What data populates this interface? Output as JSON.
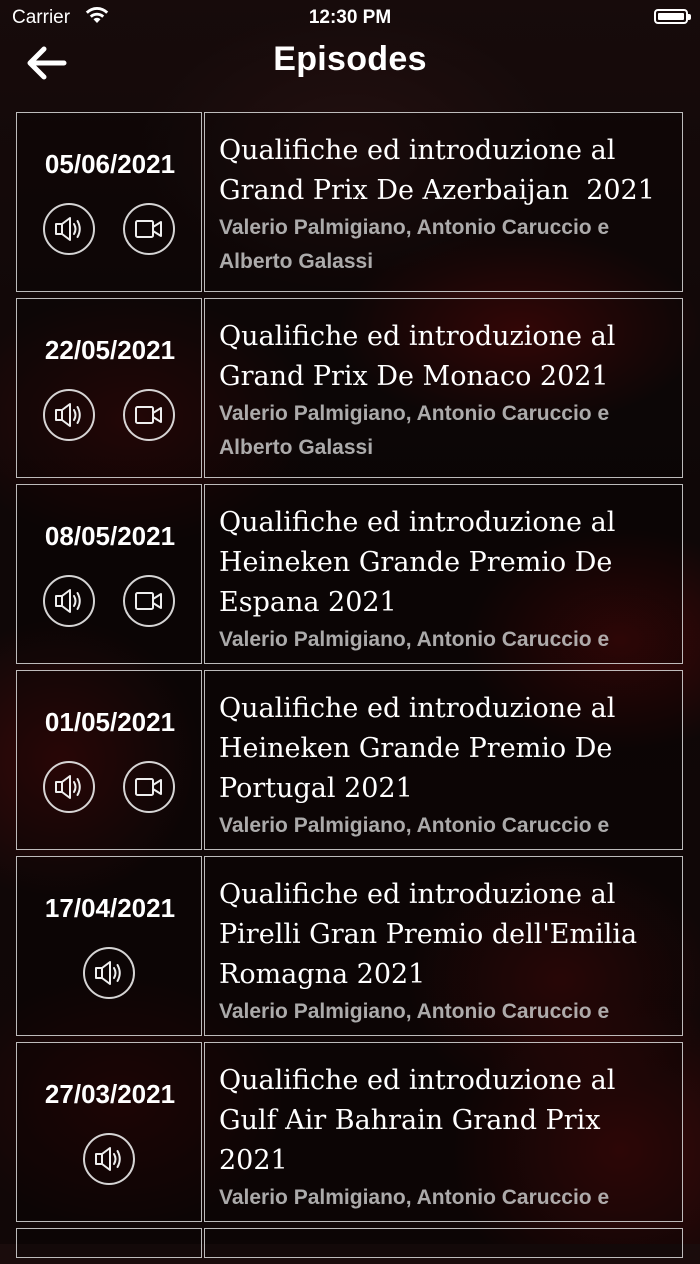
{
  "status_bar": {
    "carrier": "Carrier",
    "time": "12:30 PM"
  },
  "header": {
    "title": "Episodes",
    "back_icon": "arrow-left-icon"
  },
  "episodes": [
    {
      "date": "05/06/2021",
      "title": "Qualifiche ed introduzione al\nGrand Prix De Azerbaijan  2021",
      "authors": "Valerio Palmigiano, Antonio Caruccio e\nAlberto Galassi",
      "has_audio": true,
      "has_video": true
    },
    {
      "date": "22/05/2021",
      "title": "Qualifiche ed introduzione al\nGrand Prix De Monaco 2021",
      "authors": "Valerio Palmigiano, Antonio Caruccio e\nAlberto Galassi",
      "has_audio": true,
      "has_video": true
    },
    {
      "date": "08/05/2021",
      "title": "Qualifiche ed introduzione al\nHeineken Grande Premio De\nEspana 2021",
      "authors": "Valerio Palmigiano, Antonio Caruccio e",
      "has_audio": true,
      "has_video": true
    },
    {
      "date": "01/05/2021",
      "title": "Qualifiche ed introduzione al\nHeineken Grande Premio De\nPortugal 2021",
      "authors": "Valerio Palmigiano, Antonio Caruccio e",
      "has_audio": true,
      "has_video": true
    },
    {
      "date": "17/04/2021",
      "title": "Qualifiche ed introduzione al\nPirelli Gran Premio dell'Emilia\nRomagna 2021",
      "authors": "Valerio Palmigiano, Antonio Caruccio e",
      "has_audio": true,
      "has_video": false
    },
    {
      "date": "27/03/2021",
      "title": "Qualifiche ed introduzione al\nGulf Air Bahrain Grand Prix\n2021",
      "authors": "Valerio Palmigiano, Antonio Caruccio e",
      "has_audio": true,
      "has_video": false
    }
  ],
  "icons": {
    "audio": "speaker-icon",
    "video": "video-camera-icon"
  }
}
